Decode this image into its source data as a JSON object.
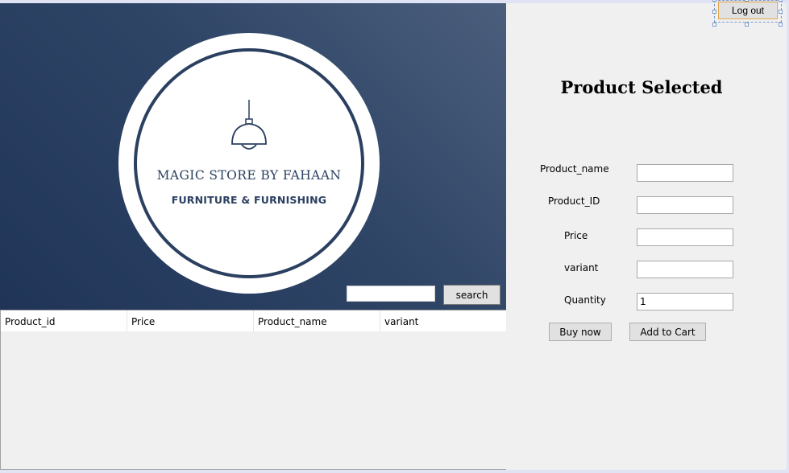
{
  "banner": {
    "store_name": "MAGIC STORE BY FAHAAN",
    "tagline": "FURNITURE & FURNISHING",
    "colors": {
      "gradient_dark": "#1f3457",
      "gradient_light": "#4b5e7c",
      "logo_ink": "#2b4060"
    },
    "icon": "pendant-lamp-icon"
  },
  "search": {
    "value": "",
    "button_label": "search"
  },
  "table": {
    "columns": [
      "Product_id",
      "Price",
      "Product_name",
      "variant"
    ],
    "rows": []
  },
  "toolbar": {
    "logout_label": "Log out"
  },
  "panel": {
    "title": "Product Selected",
    "fields": {
      "name_label": "Product_name",
      "name_value": "",
      "id_label": "Product_ID",
      "id_value": "",
      "price_label": "Price",
      "price_value": "",
      "variant_label": "variant",
      "variant_value": "",
      "quantity_label": "Quantity",
      "quantity_value": "1"
    },
    "buy_label": "Buy now",
    "cart_label": "Add to Cart"
  }
}
